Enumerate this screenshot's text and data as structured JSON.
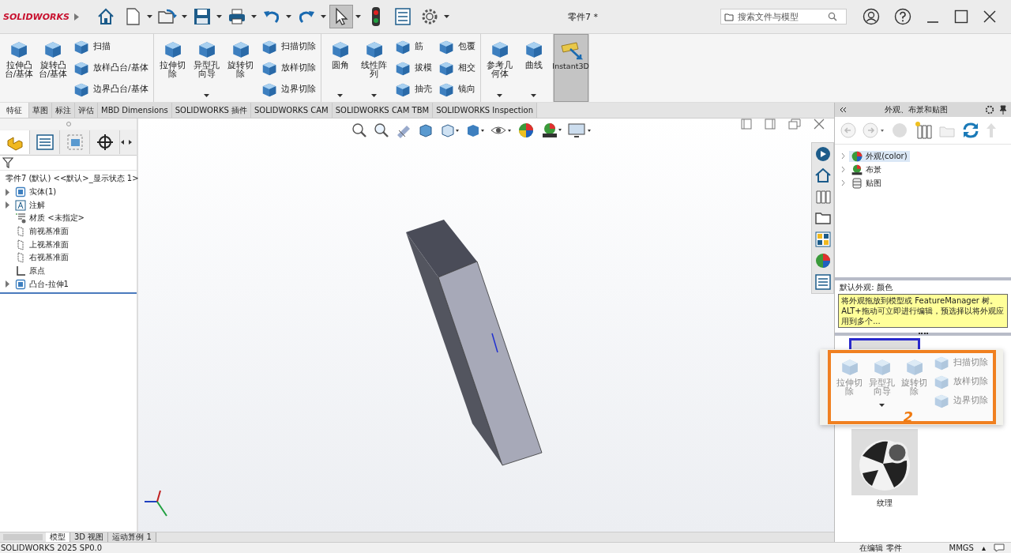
{
  "titlebar": {
    "logo": "SOLIDWORKS",
    "document_title": "零件7 *",
    "search": {
      "placeholder": "搜索文件与模型"
    }
  },
  "quick_toolbar": [
    {
      "kind": "home",
      "dropdown": false,
      "selected": false
    },
    {
      "kind": "new",
      "dropdown": true,
      "selected": false
    },
    {
      "kind": "open",
      "dropdown": true,
      "selected": false
    },
    {
      "kind": "save",
      "dropdown": true,
      "selected": false
    },
    {
      "kind": "print",
      "dropdown": true,
      "selected": false
    },
    {
      "kind": "undo",
      "dropdown": true,
      "selected": false
    },
    {
      "kind": "redo",
      "dropdown": true,
      "selected": false
    },
    {
      "kind": "select",
      "dropdown": true,
      "selected": true
    },
    {
      "kind": "rebuild",
      "dropdown": false,
      "selected": false
    },
    {
      "kind": "properties",
      "dropdown": false,
      "selected": false
    },
    {
      "kind": "options",
      "dropdown": true,
      "selected": false
    }
  ],
  "ribbon": {
    "groups": [
      {
        "columns": [
          {
            "kind": "large",
            "label": "拉伸凸台/基体",
            "dropdown": false
          },
          {
            "kind": "large",
            "label": "旋转凸台/基体",
            "dropdown": false
          },
          {
            "kind": "stack",
            "items": [
              {
                "label": "扫描"
              },
              {
                "label": "放样凸台/基体"
              },
              {
                "label": "边界凸台/基体"
              }
            ]
          }
        ]
      },
      {
        "columns": [
          {
            "kind": "large",
            "label": "拉伸切除",
            "dropdown": false
          },
          {
            "kind": "large",
            "label": "异型孔向导",
            "dropdown": true
          },
          {
            "kind": "large",
            "label": "旋转切除",
            "dropdown": false
          },
          {
            "kind": "stack",
            "items": [
              {
                "label": "扫描切除"
              },
              {
                "label": "放样切除"
              },
              {
                "label": "边界切除"
              }
            ]
          }
        ]
      },
      {
        "columns": [
          {
            "kind": "large",
            "label": "圆角",
            "dropdown": true
          },
          {
            "kind": "large",
            "label": "线性阵列",
            "dropdown": true
          },
          {
            "kind": "stack",
            "items": [
              {
                "label": "筋"
              },
              {
                "label": "拔模"
              },
              {
                "label": "抽壳"
              }
            ]
          },
          {
            "kind": "stack",
            "items": [
              {
                "label": "包覆"
              },
              {
                "label": "相交"
              },
              {
                "label": "镜向"
              }
            ]
          }
        ]
      },
      {
        "columns": [
          {
            "kind": "large",
            "label": "参考几何体",
            "dropdown": true
          },
          {
            "kind": "large",
            "label": "曲线",
            "dropdown": true
          }
        ]
      },
      {
        "columns": [
          {
            "kind": "toggle",
            "label": "Instant3D",
            "on": true
          }
        ]
      }
    ]
  },
  "tabs": [
    {
      "label": "特征",
      "selected": true
    },
    {
      "label": "草图",
      "selected": false
    },
    {
      "label": "标注",
      "selected": false
    },
    {
      "label": "评估",
      "selected": false
    },
    {
      "label": "MBD Dimensions",
      "selected": false
    },
    {
      "label": "SOLIDWORKS 插件",
      "selected": false
    },
    {
      "label": "SOLIDWORKS CAM",
      "selected": false
    },
    {
      "label": "SOLIDWORKS CAM TBM",
      "selected": false
    },
    {
      "label": "SOLIDWORKS Inspection",
      "selected": false
    }
  ],
  "feature_manager": {
    "tabs": [
      {
        "kind": "tree",
        "selected": true
      },
      {
        "kind": "properties",
        "selected": false
      },
      {
        "kind": "configurations",
        "selected": false
      },
      {
        "kind": "target",
        "selected": false
      }
    ],
    "tree": {
      "label": "零件7 (默认) <<默认>_显示状态 1>",
      "children": [
        {
          "label": "实体(1)",
          "kind": "bodies",
          "expandable": true,
          "expanded": false
        },
        {
          "label": "注解",
          "kind": "annotations",
          "expandable": true,
          "expanded": false
        },
        {
          "label": "材质 <未指定>",
          "kind": "material",
          "expandable": false,
          "expanded": false
        },
        {
          "label": "前视基准面",
          "kind": "plane",
          "expandable": false,
          "expanded": false
        },
        {
          "label": "上视基准面",
          "kind": "plane",
          "expandable": false,
          "expanded": false
        },
        {
          "label": "右视基准面",
          "kind": "plane",
          "expandable": false,
          "expanded": false
        },
        {
          "label": "原点",
          "kind": "origin",
          "expandable": false,
          "expanded": false
        },
        {
          "label": "凸台-拉伸1",
          "kind": "feature",
          "expandable": true,
          "expanded": false
        }
      ]
    }
  },
  "task_pane": {
    "title": "外观、布景和贴图",
    "tree": [
      {
        "label": "外观(color)",
        "kind": "appearance",
        "selected": true
      },
      {
        "label": "布景",
        "kind": "scene",
        "selected": false
      },
      {
        "label": "贴图",
        "kind": "decal",
        "selected": false
      }
    ],
    "caption": "默认外观: 颜色",
    "tooltip": "将外观拖放到模型或 FeatureManager 树。ALT+拖动可立即进行编辑，预选择以将外观应用到多个...",
    "thumbnails": [
      {
        "kind": "color",
        "selected": true
      },
      {
        "kind": "texture",
        "label": "纹理",
        "selected": false
      }
    ]
  },
  "overlay": {
    "columns": [
      {
        "kind": "large",
        "label": "拉伸切除",
        "dropdown": false
      },
      {
        "kind": "large",
        "label": "异型孔向导",
        "dropdown": true
      },
      {
        "kind": "large",
        "label": "旋转切除",
        "dropdown": false
      },
      {
        "kind": "stack",
        "items": [
          {
            "label": "扫描切除"
          },
          {
            "label": "放样切除"
          },
          {
            "label": "边界切除"
          }
        ]
      }
    ],
    "annotation": "2"
  },
  "model_tabs": [
    {
      "label": "模型",
      "selected": true
    },
    {
      "label": "3D 视图",
      "selected": false
    },
    {
      "label": "运动算例 1",
      "selected": false
    }
  ],
  "status_bar": {
    "version": "SOLIDWORKS 2025 SP0.0",
    "mode": "在编辑 零件",
    "units": "MMGS",
    "units_menu": "▴"
  }
}
